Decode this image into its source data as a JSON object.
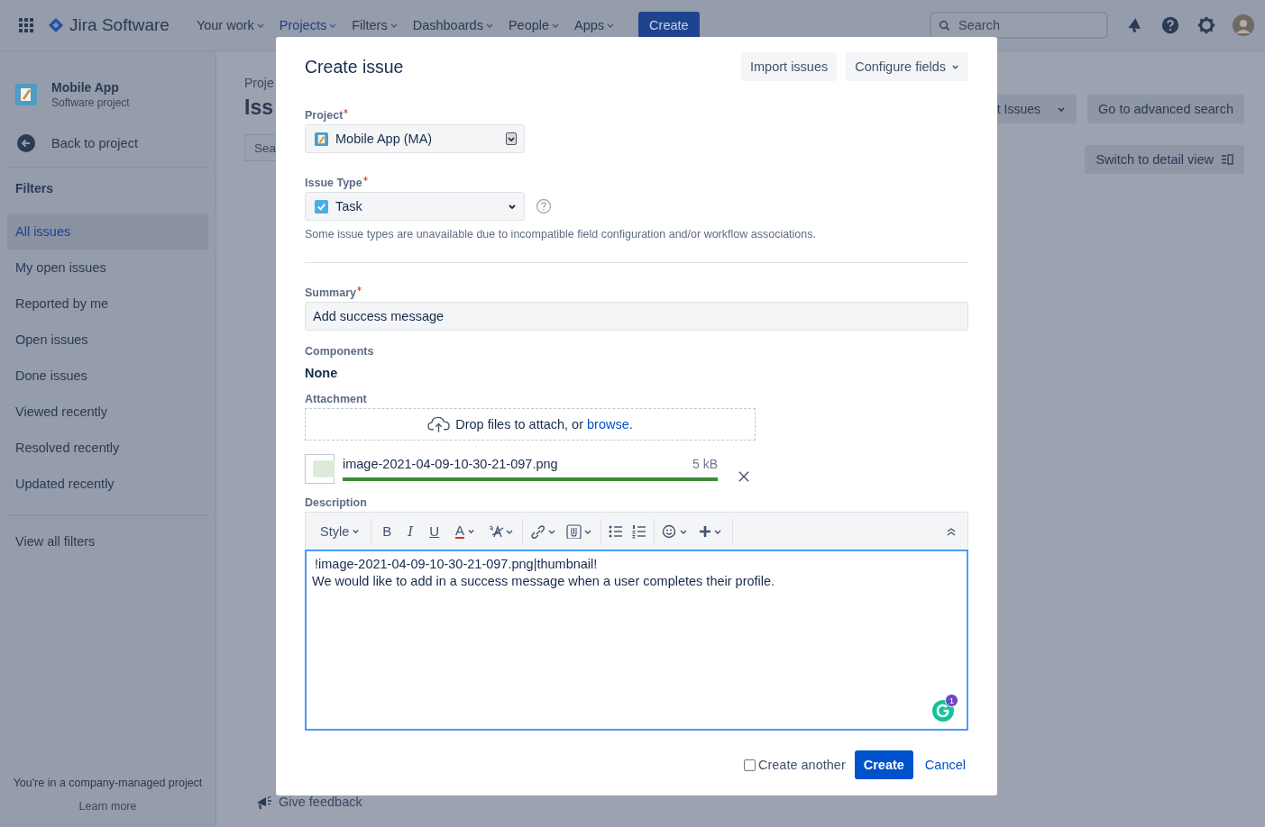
{
  "nav": {
    "product": "Jira Software",
    "items": [
      {
        "label": "Your work",
        "selected": false
      },
      {
        "label": "Projects",
        "selected": true
      },
      {
        "label": "Filters",
        "selected": false
      },
      {
        "label": "Dashboards",
        "selected": false
      },
      {
        "label": "People",
        "selected": false
      },
      {
        "label": "Apps",
        "selected": false
      }
    ],
    "create": "Create",
    "search": {
      "placeholder": "Search"
    }
  },
  "sidebar": {
    "project": {
      "name": "Mobile App",
      "type": "Software project"
    },
    "back": "Back to project",
    "filters_heading": "Filters",
    "items": [
      {
        "label": "All issues",
        "selected": true
      },
      {
        "label": "My open issues",
        "selected": false
      },
      {
        "label": "Reported by me",
        "selected": false
      },
      {
        "label": "Open issues",
        "selected": false
      },
      {
        "label": "Done issues",
        "selected": false
      },
      {
        "label": "Viewed recently",
        "selected": false
      },
      {
        "label": "Resolved recently",
        "selected": false
      },
      {
        "label": "Updated recently",
        "selected": false
      }
    ],
    "view_all": "View all filters",
    "footer": {
      "text": "You're in a company-managed project",
      "link": "Learn more"
    }
  },
  "page": {
    "breadcrumb": "Proje",
    "title": "Iss",
    "search": {
      "placeholder": "Sea"
    },
    "buttons": [
      {
        "label": "t Issues",
        "kind": "dropdown"
      },
      {
        "label": "Go to advanced search",
        "kind": "plain"
      }
    ],
    "detail_view": "Switch to detail view",
    "feedback": "Give feedback"
  },
  "modal": {
    "title": "Create issue",
    "header_buttons": [
      {
        "label": "Import issues",
        "kind": "plain"
      },
      {
        "label": "Configure fields",
        "kind": "dropdown"
      }
    ],
    "project": {
      "label": "Project",
      "required": true,
      "value": "Mobile App (MA)"
    },
    "issue_type": {
      "label": "Issue Type",
      "required": true,
      "value": "Task",
      "note": "Some issue types are unavailable due to incompatible field configuration and/or workflow associations."
    },
    "summary": {
      "label": "Summary",
      "required": true,
      "value": "Add success message"
    },
    "components": {
      "label": "Components",
      "value": "None"
    },
    "attachment": {
      "label": "Attachment",
      "text": "Drop files to attach, or ",
      "link": "browse",
      "after": ".",
      "file": {
        "name": "image-2021-04-09-10-30-21-097.png",
        "size": "5 kB",
        "level": 1
      }
    },
    "description": {
      "label": "Description",
      "toolbar": [
        [
          {
            "kind": "style",
            "label": "Style"
          }
        ],
        [
          {
            "kind": "bold",
            "label": "B"
          },
          {
            "kind": "italic",
            "label": "I"
          },
          {
            "kind": "underline",
            "label": "U"
          },
          {
            "kind": "color",
            "label": "A"
          },
          {
            "kind": "text-size"
          }
        ],
        [
          {
            "kind": "link"
          },
          {
            "kind": "attachment"
          }
        ],
        [
          {
            "kind": "bullet-list"
          },
          {
            "kind": "numbered-list"
          }
        ],
        [
          {
            "kind": "emoji"
          },
          {
            "kind": "insert"
          }
        ],
        [
          {
            "kind": "collapse"
          }
        ]
      ],
      "lines": [
        "!image-2021-04-09-10-30-21-097.png|thumbnail!",
        "We would like to add in a success message when a user completes their profile."
      ],
      "assistant_count": "1"
    },
    "create_another": {
      "label": "Create another",
      "checked": false
    },
    "submit": "Create",
    "cancel": "Cancel"
  }
}
